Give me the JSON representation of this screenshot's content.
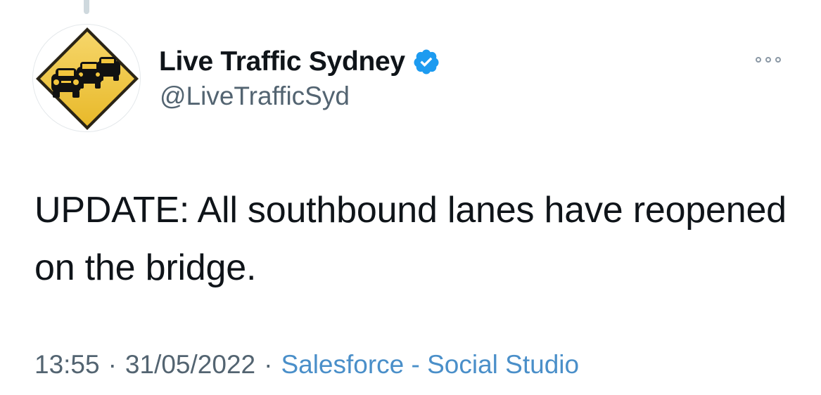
{
  "tweet": {
    "author": {
      "display_name": "Live Traffic Sydney",
      "handle": "@LiveTrafficSyd",
      "verified": true,
      "avatar_icon": "traffic-warning-sign-icon",
      "verified_icon": "verified-badge-icon"
    },
    "text": "UPDATE: All southbound lanes have reopened on the bridge.",
    "time": "13:55",
    "date": "31/05/2022",
    "separator": "·",
    "source": "Salesforce - Social Studio",
    "more_icon": "more-options-icon"
  },
  "colors": {
    "text_primary": "#0f1419",
    "text_secondary": "#536471",
    "link": "#4a8fc9",
    "verified": "#1d9bf0",
    "sign_yellow": "#f2c53d"
  }
}
